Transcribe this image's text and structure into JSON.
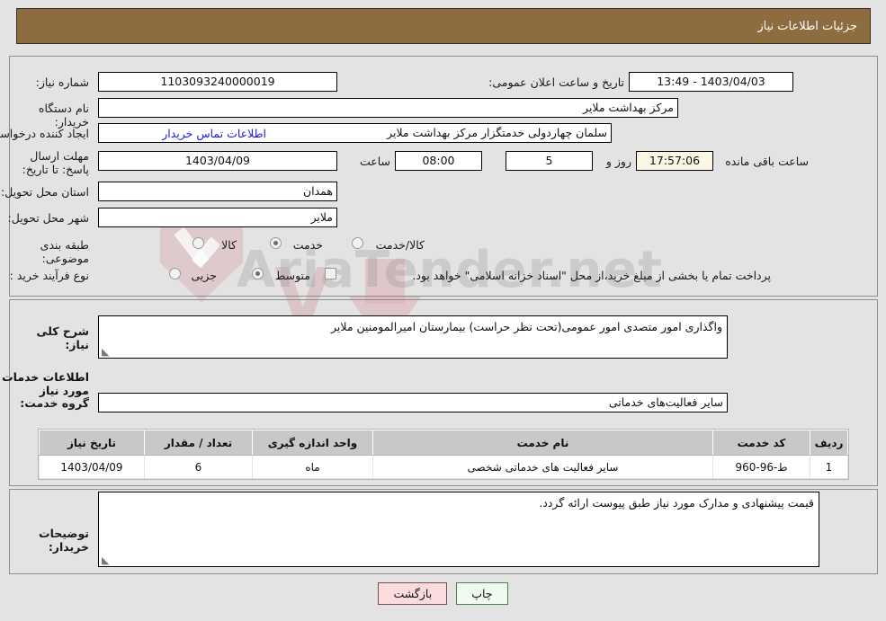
{
  "header": {
    "title": "جزئیات اطلاعات نیاز"
  },
  "top_form": {
    "need_number_label": "شماره نیاز:",
    "need_number_value": "1103093240000019",
    "announce_label": "تاریخ و ساعت اعلان عمومی:",
    "announce_value": "1403/04/03 - 13:49",
    "buyer_org_label": "نام دستگاه خریدار:",
    "buyer_org_value": "مرکز بهداشت ملایر",
    "requester_label": "ایجاد کننده درخواست:",
    "requester_value": "سلمان چهاردولی خدمتگزار مرکز بهداشت ملایر",
    "contact_link": "اطلاعات تماس خریدار",
    "deadline_label": "مهلت ارسال پاسخ: تا تاریخ:",
    "deadline_date": "1403/04/09",
    "hour_label": "ساعت",
    "deadline_time": "08:00",
    "days_value": "5",
    "days_suffix": "روز و",
    "countdown_value": "17:57:06",
    "countdown_suffix": "ساعت باقی مانده",
    "province_label": "استان محل تحویل:",
    "province_value": "همدان",
    "city_label": "شهر محل تحویل:",
    "city_value": "ملایر",
    "category_label": "طبقه بندی موضوعی:",
    "category_options": [
      "کالا",
      "خدمت",
      "کالا/خدمت"
    ],
    "category_selected": "خدمت",
    "process_label": "نوع فرآیند خرید :",
    "process_options": [
      "جزیی",
      "متوسط"
    ],
    "process_selected": "متوسط",
    "treasury_note": "پرداخت تمام یا بخشی از مبلغ خرید،از محل \"اسناد خزانه اسلامی\" خواهد بود."
  },
  "middle": {
    "summary_label": "شرح کلی نیاز:",
    "summary_value": "واگذاری امور متصدی امور عمومی(تحت نظر حراست) بیمارستان امیرالمومنین ملایر",
    "services_heading": "اطلاعات خدمات مورد نیاز",
    "service_group_label": "گروه خدمت:",
    "service_group_value": "سایر فعالیت‌های خدماتی"
  },
  "table": {
    "columns": [
      "ردیف",
      "کد خدمت",
      "نام خدمت",
      "واحد اندازه گیری",
      "تعداد / مقدار",
      "تاریخ نیاز"
    ],
    "rows": [
      {
        "row_no": "1",
        "service_code": "ط-96-960",
        "service_name": "سایر فعالیت های خدماتی شخصی",
        "unit": "ماه",
        "quantity": "6",
        "need_date": "1403/04/09"
      }
    ]
  },
  "notes": {
    "label": "توضیحات خریدار:",
    "value": "قیمت پیشنهادی و مدارک مورد نیاز طبق پیوست ارائه گردد."
  },
  "buttons": {
    "print": "چاپ",
    "back": "بازگشت"
  },
  "watermark": {
    "text": "AriaTender.net"
  },
  "colors": {
    "header_bg": "#8d6c3f",
    "page_bg": "#e3e3e3",
    "table_header_bg": "#c8c8c8",
    "link": "#1a1ae0",
    "countdown_bg": "#fbf7e4",
    "print_btn_bg": "#eefbee",
    "back_btn_bg": "#fbdcdc"
  }
}
